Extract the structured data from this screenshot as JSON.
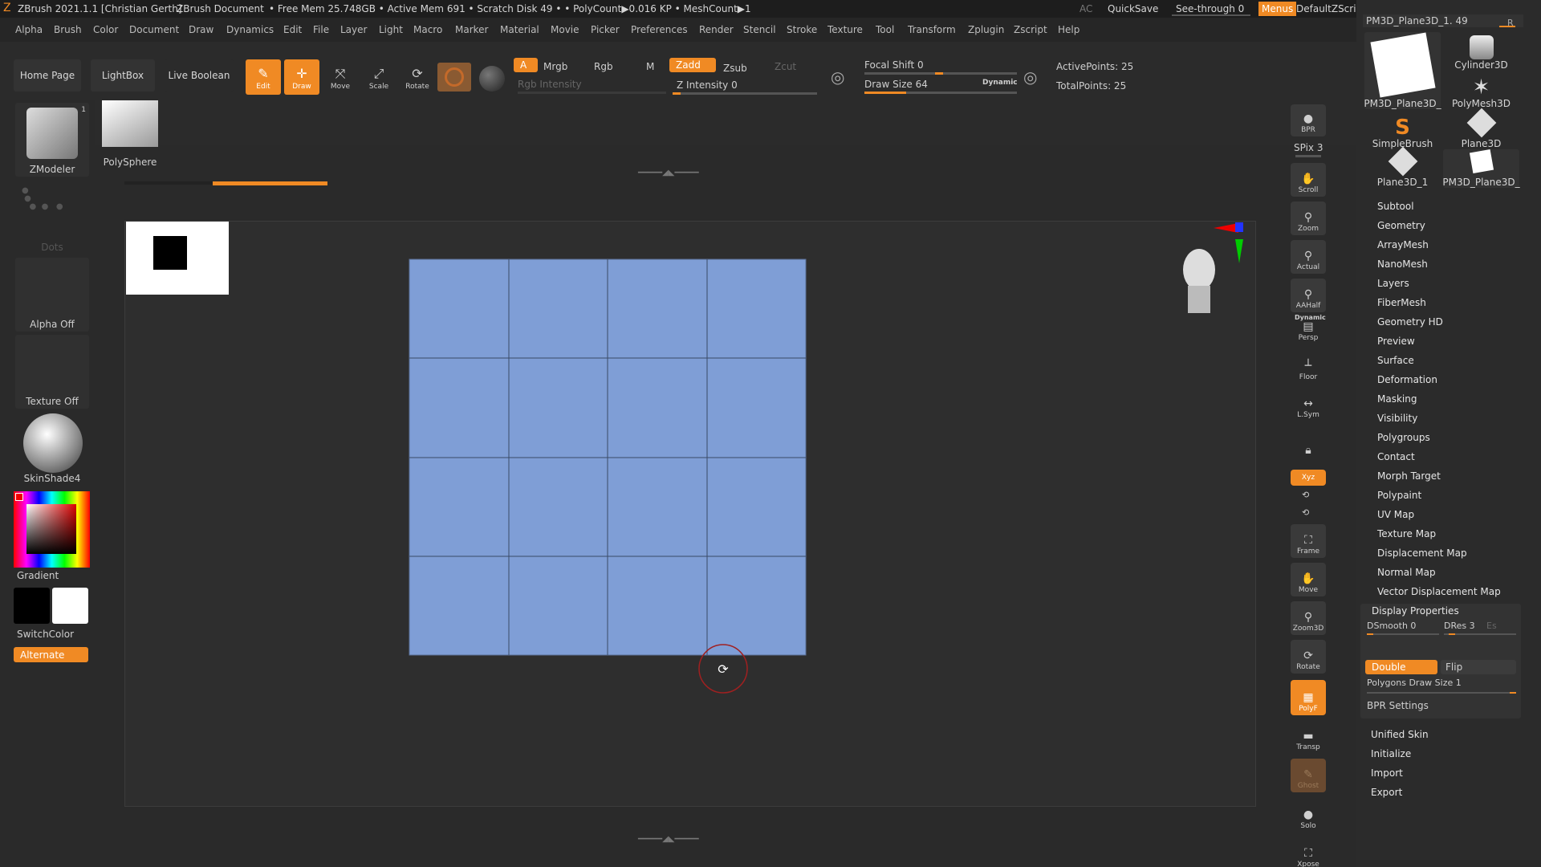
{
  "titlebar": {
    "app": "ZBrush 2021.1.1 [Christian Gerth]",
    "document": "ZBrush Document",
    "stats": "• Free Mem 25.748GB • Active Mem 691 • Scratch Disk 49 • • PolyCount▶0.016 KP • MeshCount▶1",
    "ac": "AC",
    "quicksave": "QuickSave",
    "see_through": "See-through 0",
    "menus": "Menus",
    "script": "DefaultZScript"
  },
  "menubar": [
    "Alpha",
    "Brush",
    "Color",
    "Document",
    "Draw",
    "Dynamics",
    "Edit",
    "File",
    "Layer",
    "Light",
    "Macro",
    "Marker",
    "Material",
    "Movie",
    "Picker",
    "Preferences",
    "Render",
    "Stencil",
    "Stroke",
    "Texture",
    "Tool",
    "Transform",
    "Zplugin",
    "Zscript",
    "Help"
  ],
  "shelf": {
    "home_page": "Home Page",
    "lightbox": "LightBox",
    "live_boolean": "Live Boolean",
    "edit": "Edit",
    "draw": "Draw",
    "move": "Move",
    "scale": "Scale",
    "rotate": "Rotate",
    "a": "A",
    "mrgb": "Mrgb",
    "rgb": "Rgb",
    "m": "M",
    "zadd": "Zadd",
    "zsub": "Zsub",
    "zcut": "Zcut",
    "rgb_intensity": "Rgb Intensity",
    "z_intensity": "Z Intensity 0",
    "focal_shift": "Focal Shift 0",
    "draw_size": "Draw Size 64",
    "dynamic": "Dynamic",
    "active_points": "ActivePoints: 25",
    "total_points": "TotalPoints: 25"
  },
  "left": {
    "zmodeler": "ZModeler",
    "zmodeler_badge": "1",
    "polysphere": "PolySphere",
    "dots": "Dots",
    "alpha_off": "Alpha Off",
    "texture_off": "Texture Off",
    "material": "SkinShade4",
    "gradient": "Gradient",
    "switch_color": "SwitchColor",
    "alternate": "Alternate"
  },
  "rightshelf": [
    "BPR",
    "SPix 3",
    "Scroll",
    "Zoom",
    "Actual",
    "AAHalf",
    "Persp",
    "Floor",
    "L.Sym",
    "Lock",
    "Xyz",
    "Frame",
    "Move",
    "Zoom3D",
    "Rotate",
    "PolyF",
    "Transp",
    "Ghost",
    "Solo",
    "Xpose"
  ],
  "rightshelf_dynamic": "Dynamic",
  "rightpanel": {
    "current_tool": "PM3D_Plane3D_1. 49",
    "r": "R",
    "meshes": [
      "PM3D_Plane3D_",
      "Cylinder3D",
      "",
      "PolyMesh3D",
      "SimpleBrush",
      "Plane3D",
      "Plane3D_1",
      "PM3D_Plane3D_"
    ],
    "menu": [
      "Subtool",
      "Geometry",
      "ArrayMesh",
      "NanoMesh",
      "Layers",
      "FiberMesh",
      "Geometry HD",
      "Preview",
      "Surface",
      "Deformation",
      "Masking",
      "Visibility",
      "Polygroups",
      "Contact",
      "Morph Target",
      "Polypaint",
      "UV Map",
      "Texture Map",
      "Displacement Map",
      "Normal Map",
      "Vector Displacement Map",
      "Display Properties"
    ],
    "dsmooth": "DSmooth 0",
    "dres": "DRes 3",
    "es": "Es",
    "double": "Double",
    "flip": "Flip",
    "poly_draw_size": "Polygons Draw Size 1",
    "bpr_settings": "BPR Settings",
    "menu2": [
      "Unified Skin",
      "Initialize",
      "Import",
      "Export"
    ]
  },
  "colors": {
    "accent": "#f08a24",
    "mesh": "#7f9ed6",
    "bg": "#2a2a2a"
  }
}
